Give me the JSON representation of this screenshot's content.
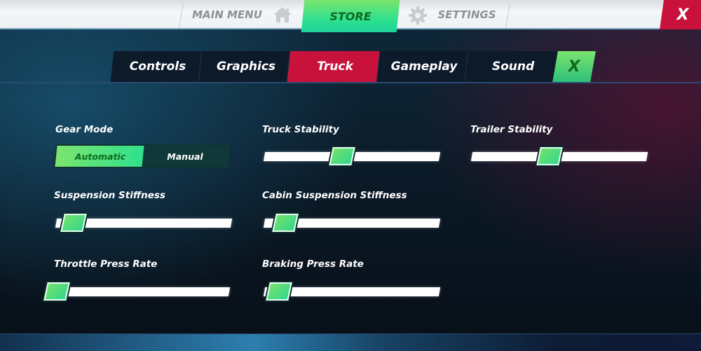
{
  "topbar": {
    "main_menu_label": "MAIN MENU",
    "main_menu_icon": "home-icon",
    "store_label": "STORE",
    "settings_icon": "gear-icon",
    "settings_label": "SETTINGS",
    "close_label": "X"
  },
  "tabs": {
    "items": [
      {
        "label": "Controls",
        "active": false
      },
      {
        "label": "Graphics",
        "active": false
      },
      {
        "label": "Truck",
        "active": true
      },
      {
        "label": "Gameplay",
        "active": false
      },
      {
        "label": "Sound",
        "active": false
      }
    ],
    "close_label": "X"
  },
  "settings": {
    "gear_mode": {
      "label": "Gear Mode",
      "options": [
        "Automatic",
        "Manual"
      ],
      "selected": "Automatic"
    },
    "sliders": [
      {
        "id": "truck-stability",
        "label": "Truck Stability",
        "value": 0.5
      },
      {
        "id": "trailer-stability",
        "label": "Trailer Stability",
        "value": 0.5
      },
      {
        "id": "suspension-stiffness",
        "label": "Suspension Stiffness",
        "value": 0.1
      },
      {
        "id": "cabin-suspension-stiffness",
        "label": "Cabin Suspension Stiffness",
        "value": 0.12
      },
      {
        "id": "throttle-press-rate",
        "label": "Throttle Press Rate",
        "value": 0.0
      },
      {
        "id": "braking-press-rate",
        "label": "Braking Press Rate",
        "value": 0.08
      }
    ]
  },
  "colors": {
    "accent_green": "#2fe08e",
    "accent_red": "#c8123b",
    "tab_dark": "#0d1a2a"
  }
}
